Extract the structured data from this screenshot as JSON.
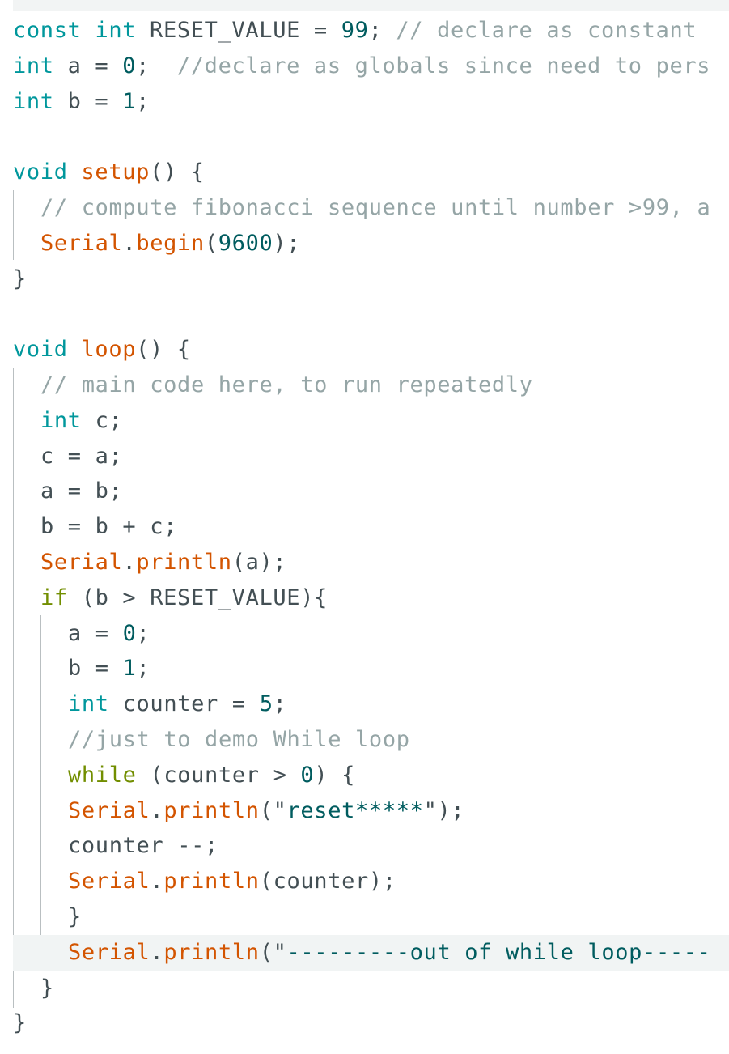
{
  "editor": {
    "language": "Arduino C++",
    "colors": {
      "keyword": "#00979c",
      "control": "#728e00",
      "function": "#d35400",
      "number": "#005c5f",
      "comment": "#95a5a6",
      "text": "#434f54"
    },
    "lines": [
      {
        "indent": 0,
        "tokens": [
          [
            "kw",
            "const"
          ],
          [
            "plain",
            " "
          ],
          [
            "kw",
            "int"
          ],
          [
            "plain",
            " RESET_VALUE = "
          ],
          [
            "num",
            "99"
          ],
          [
            "plain",
            "; "
          ],
          [
            "cmt",
            "// declare as constant"
          ]
        ]
      },
      {
        "indent": 0,
        "tokens": [
          [
            "kw",
            "int"
          ],
          [
            "plain",
            " a = "
          ],
          [
            "num",
            "0"
          ],
          [
            "plain",
            ";  "
          ],
          [
            "cmt",
            "//declare as globals since need to pers"
          ]
        ]
      },
      {
        "indent": 0,
        "tokens": [
          [
            "kw",
            "int"
          ],
          [
            "plain",
            " b = "
          ],
          [
            "num",
            "1"
          ],
          [
            "plain",
            ";"
          ]
        ]
      },
      {
        "indent": 0,
        "tokens": []
      },
      {
        "indent": 0,
        "tokens": [
          [
            "kw",
            "void"
          ],
          [
            "plain",
            " "
          ],
          [
            "fn",
            "setup"
          ],
          [
            "plain",
            "() {"
          ]
        ]
      },
      {
        "indent": 1,
        "tokens": [
          [
            "cmt",
            "// compute fibonacci sequence until number >99, a"
          ]
        ]
      },
      {
        "indent": 1,
        "tokens": [
          [
            "fn",
            "Serial"
          ],
          [
            "plain",
            "."
          ],
          [
            "fn",
            "begin"
          ],
          [
            "plain",
            "("
          ],
          [
            "num",
            "9600"
          ],
          [
            "plain",
            ");"
          ]
        ]
      },
      {
        "indent": 0,
        "tokens": [
          [
            "plain",
            "}"
          ]
        ]
      },
      {
        "indent": 0,
        "tokens": []
      },
      {
        "indent": 0,
        "tokens": [
          [
            "kw",
            "void"
          ],
          [
            "plain",
            " "
          ],
          [
            "fn",
            "loop"
          ],
          [
            "plain",
            "() {"
          ]
        ]
      },
      {
        "indent": 1,
        "tokens": [
          [
            "cmt",
            "// main code here, to run repeatedly"
          ]
        ]
      },
      {
        "indent": 1,
        "tokens": [
          [
            "kw",
            "int"
          ],
          [
            "plain",
            " c;"
          ]
        ]
      },
      {
        "indent": 1,
        "tokens": [
          [
            "plain",
            "c = a;"
          ]
        ]
      },
      {
        "indent": 1,
        "tokens": [
          [
            "plain",
            "a = b;"
          ]
        ]
      },
      {
        "indent": 1,
        "tokens": [
          [
            "plain",
            "b = b + c;"
          ]
        ]
      },
      {
        "indent": 1,
        "tokens": [
          [
            "fn",
            "Serial"
          ],
          [
            "plain",
            "."
          ],
          [
            "fn",
            "println"
          ],
          [
            "plain",
            "(a);"
          ]
        ]
      },
      {
        "indent": 1,
        "tokens": [
          [
            "kw2",
            "if"
          ],
          [
            "plain",
            " (b > RESET_VALUE){"
          ]
        ]
      },
      {
        "indent": 2,
        "tokens": [
          [
            "plain",
            "a = "
          ],
          [
            "num",
            "0"
          ],
          [
            "plain",
            ";"
          ]
        ]
      },
      {
        "indent": 2,
        "tokens": [
          [
            "plain",
            "b = "
          ],
          [
            "num",
            "1"
          ],
          [
            "plain",
            ";"
          ]
        ]
      },
      {
        "indent": 2,
        "tokens": [
          [
            "kw",
            "int"
          ],
          [
            "plain",
            " counter = "
          ],
          [
            "num",
            "5"
          ],
          [
            "plain",
            ";"
          ]
        ]
      },
      {
        "indent": 2,
        "tokens": [
          [
            "cmt",
            "//just to demo While loop"
          ]
        ]
      },
      {
        "indent": 2,
        "tokens": [
          [
            "kw2",
            "while"
          ],
          [
            "plain",
            " (counter > "
          ],
          [
            "num",
            "0"
          ],
          [
            "plain",
            ") {"
          ]
        ]
      },
      {
        "indent": 2,
        "tokens": [
          [
            "fn",
            "Serial"
          ],
          [
            "plain",
            "."
          ],
          [
            "fn",
            "println"
          ],
          [
            "plain",
            "(\""
          ],
          [
            "str",
            "reset*****"
          ],
          [
            "plain",
            "\");"
          ]
        ]
      },
      {
        "indent": 2,
        "tokens": [
          [
            "plain",
            "counter --;"
          ]
        ]
      },
      {
        "indent": 2,
        "tokens": [
          [
            "fn",
            "Serial"
          ],
          [
            "plain",
            "."
          ],
          [
            "fn",
            "println"
          ],
          [
            "plain",
            "(counter);"
          ]
        ]
      },
      {
        "indent": 2,
        "tokens": [
          [
            "plain",
            "}"
          ]
        ]
      },
      {
        "indent": 2,
        "current": true,
        "tokens": [
          [
            "fn",
            "Serial"
          ],
          [
            "plain",
            "."
          ],
          [
            "fn",
            "println"
          ],
          [
            "plain",
            "(\""
          ],
          [
            "str",
            "---------out of while loop-----"
          ]
        ]
      },
      {
        "indent": 1,
        "tokens": [
          [
            "plain",
            "}"
          ]
        ]
      },
      {
        "indent": 0,
        "tokens": [
          [
            "plain",
            "}"
          ]
        ]
      }
    ]
  }
}
